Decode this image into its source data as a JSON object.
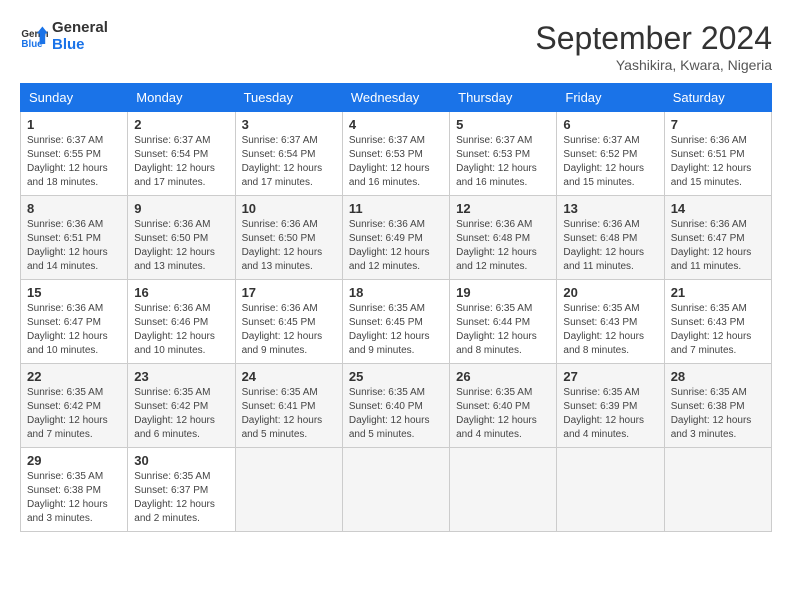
{
  "header": {
    "logo_general": "General",
    "logo_blue": "Blue",
    "month": "September 2024",
    "location": "Yashikira, Kwara, Nigeria"
  },
  "days_of_week": [
    "Sunday",
    "Monday",
    "Tuesday",
    "Wednesday",
    "Thursday",
    "Friday",
    "Saturday"
  ],
  "weeks": [
    [
      {
        "day": "1",
        "sunrise": "6:37 AM",
        "sunset": "6:55 PM",
        "daylight": "12 hours and 18 minutes."
      },
      {
        "day": "2",
        "sunrise": "6:37 AM",
        "sunset": "6:54 PM",
        "daylight": "12 hours and 17 minutes."
      },
      {
        "day": "3",
        "sunrise": "6:37 AM",
        "sunset": "6:54 PM",
        "daylight": "12 hours and 17 minutes."
      },
      {
        "day": "4",
        "sunrise": "6:37 AM",
        "sunset": "6:53 PM",
        "daylight": "12 hours and 16 minutes."
      },
      {
        "day": "5",
        "sunrise": "6:37 AM",
        "sunset": "6:53 PM",
        "daylight": "12 hours and 16 minutes."
      },
      {
        "day": "6",
        "sunrise": "6:37 AM",
        "sunset": "6:52 PM",
        "daylight": "12 hours and 15 minutes."
      },
      {
        "day": "7",
        "sunrise": "6:36 AM",
        "sunset": "6:51 PM",
        "daylight": "12 hours and 15 minutes."
      }
    ],
    [
      {
        "day": "8",
        "sunrise": "6:36 AM",
        "sunset": "6:51 PM",
        "daylight": "12 hours and 14 minutes."
      },
      {
        "day": "9",
        "sunrise": "6:36 AM",
        "sunset": "6:50 PM",
        "daylight": "12 hours and 13 minutes."
      },
      {
        "day": "10",
        "sunrise": "6:36 AM",
        "sunset": "6:50 PM",
        "daylight": "12 hours and 13 minutes."
      },
      {
        "day": "11",
        "sunrise": "6:36 AM",
        "sunset": "6:49 PM",
        "daylight": "12 hours and 12 minutes."
      },
      {
        "day": "12",
        "sunrise": "6:36 AM",
        "sunset": "6:48 PM",
        "daylight": "12 hours and 12 minutes."
      },
      {
        "day": "13",
        "sunrise": "6:36 AM",
        "sunset": "6:48 PM",
        "daylight": "12 hours and 11 minutes."
      },
      {
        "day": "14",
        "sunrise": "6:36 AM",
        "sunset": "6:47 PM",
        "daylight": "12 hours and 11 minutes."
      }
    ],
    [
      {
        "day": "15",
        "sunrise": "6:36 AM",
        "sunset": "6:47 PM",
        "daylight": "12 hours and 10 minutes."
      },
      {
        "day": "16",
        "sunrise": "6:36 AM",
        "sunset": "6:46 PM",
        "daylight": "12 hours and 10 minutes."
      },
      {
        "day": "17",
        "sunrise": "6:36 AM",
        "sunset": "6:45 PM",
        "daylight": "12 hours and 9 minutes."
      },
      {
        "day": "18",
        "sunrise": "6:35 AM",
        "sunset": "6:45 PM",
        "daylight": "12 hours and 9 minutes."
      },
      {
        "day": "19",
        "sunrise": "6:35 AM",
        "sunset": "6:44 PM",
        "daylight": "12 hours and 8 minutes."
      },
      {
        "day": "20",
        "sunrise": "6:35 AM",
        "sunset": "6:43 PM",
        "daylight": "12 hours and 8 minutes."
      },
      {
        "day": "21",
        "sunrise": "6:35 AM",
        "sunset": "6:43 PM",
        "daylight": "12 hours and 7 minutes."
      }
    ],
    [
      {
        "day": "22",
        "sunrise": "6:35 AM",
        "sunset": "6:42 PM",
        "daylight": "12 hours and 7 minutes."
      },
      {
        "day": "23",
        "sunrise": "6:35 AM",
        "sunset": "6:42 PM",
        "daylight": "12 hours and 6 minutes."
      },
      {
        "day": "24",
        "sunrise": "6:35 AM",
        "sunset": "6:41 PM",
        "daylight": "12 hours and 5 minutes."
      },
      {
        "day": "25",
        "sunrise": "6:35 AM",
        "sunset": "6:40 PM",
        "daylight": "12 hours and 5 minutes."
      },
      {
        "day": "26",
        "sunrise": "6:35 AM",
        "sunset": "6:40 PM",
        "daylight": "12 hours and 4 minutes."
      },
      {
        "day": "27",
        "sunrise": "6:35 AM",
        "sunset": "6:39 PM",
        "daylight": "12 hours and 4 minutes."
      },
      {
        "day": "28",
        "sunrise": "6:35 AM",
        "sunset": "6:38 PM",
        "daylight": "12 hours and 3 minutes."
      }
    ],
    [
      {
        "day": "29",
        "sunrise": "6:35 AM",
        "sunset": "6:38 PM",
        "daylight": "12 hours and 3 minutes."
      },
      {
        "day": "30",
        "sunrise": "6:35 AM",
        "sunset": "6:37 PM",
        "daylight": "12 hours and 2 minutes."
      },
      null,
      null,
      null,
      null,
      null
    ]
  ],
  "labels": {
    "sunrise": "Sunrise: ",
    "sunset": "Sunset: ",
    "daylight": "Daylight: "
  }
}
